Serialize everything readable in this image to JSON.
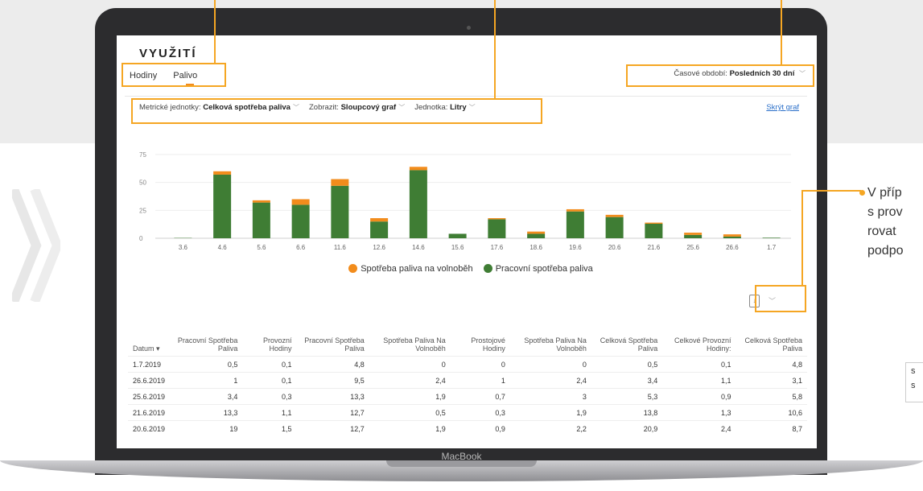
{
  "laptop_label": "MacBook",
  "app": {
    "title": "VYUŽITÍ",
    "tabs": [
      {
        "label": "Hodiny",
        "active": false
      },
      {
        "label": "Palivo",
        "active": true
      }
    ],
    "period_label": "Časové období:",
    "period_value": "Posledních 30 dní",
    "filters": {
      "metric_label": "Metrické jednotky:",
      "metric_value": "Celková spotřeba paliva",
      "view_label": "Zobrazit:",
      "view_value": "Sloupcový graf",
      "unit_label": "Jednotka:",
      "unit_value": "Litry"
    },
    "hide_chart_link": "Skrýt graf",
    "accent_color": "#f28c1c"
  },
  "chart_data": {
    "type": "bar",
    "stacked": true,
    "categories": [
      "3.6",
      "4.6",
      "5.6",
      "6.6",
      "11.6",
      "12.6",
      "14.6",
      "15.6",
      "17.6",
      "18.6",
      "19.6",
      "20.6",
      "21.6",
      "25.6",
      "26.6",
      "1.7"
    ],
    "series": [
      {
        "name": "Pracovní spotřeba paliva",
        "color": "#3f7d34",
        "values": [
          0.3,
          57,
          32,
          30,
          47,
          15,
          61,
          4,
          17,
          4,
          24,
          19,
          13,
          3,
          1.5,
          0.5
        ]
      },
      {
        "name": "Spotřeba paliva na volnoběh",
        "color": "#f28c1c",
        "values": [
          0,
          3,
          2,
          5,
          6,
          3,
          3,
          0,
          1,
          2,
          2,
          2,
          1,
          2,
          2,
          0
        ]
      }
    ],
    "yticks": [
      0,
      25,
      50,
      75
    ],
    "ylim": [
      0,
      75
    ],
    "grid": true,
    "legend_position": "bottom"
  },
  "table": {
    "headers": [
      "Datum ▾",
      "Pracovní Spotřeba Paliva",
      "Provozní Hodiny",
      "Pracovní Spotřeba Paliva",
      "Spotřeba Paliva Na Volnoběh",
      "Prostojové Hodiny",
      "Spotřeba Paliva Na Volnoběh",
      "Celková Spotřeba Paliva",
      "Celkové Provozní Hodiny:",
      "Celková Spotřeba Paliva"
    ],
    "rows": [
      [
        "1.7.2019",
        "0,5",
        "0,1",
        "4,8",
        "0",
        "0",
        "0",
        "0,5",
        "0,1",
        "4,8"
      ],
      [
        "26.6.2019",
        "1",
        "0,1",
        "9,5",
        "2,4",
        "1",
        "2,4",
        "3,4",
        "1,1",
        "3,1"
      ],
      [
        "25.6.2019",
        "3,4",
        "0,3",
        "13,3",
        "1,9",
        "0,7",
        "3",
        "5,3",
        "0,9",
        "5,8"
      ],
      [
        "21.6.2019",
        "13,3",
        "1,1",
        "12,7",
        "0,5",
        "0,3",
        "1,9",
        "13,8",
        "1,3",
        "10,6"
      ],
      [
        "20.6.2019",
        "19",
        "1,5",
        "12,7",
        "1,9",
        "0,9",
        "2,2",
        "20,9",
        "2,4",
        "8,7"
      ]
    ]
  },
  "side_text": [
    "V příp",
    "s prov",
    "rovat",
    "podpo"
  ],
  "side_box_text": [
    "s",
    "s"
  ]
}
